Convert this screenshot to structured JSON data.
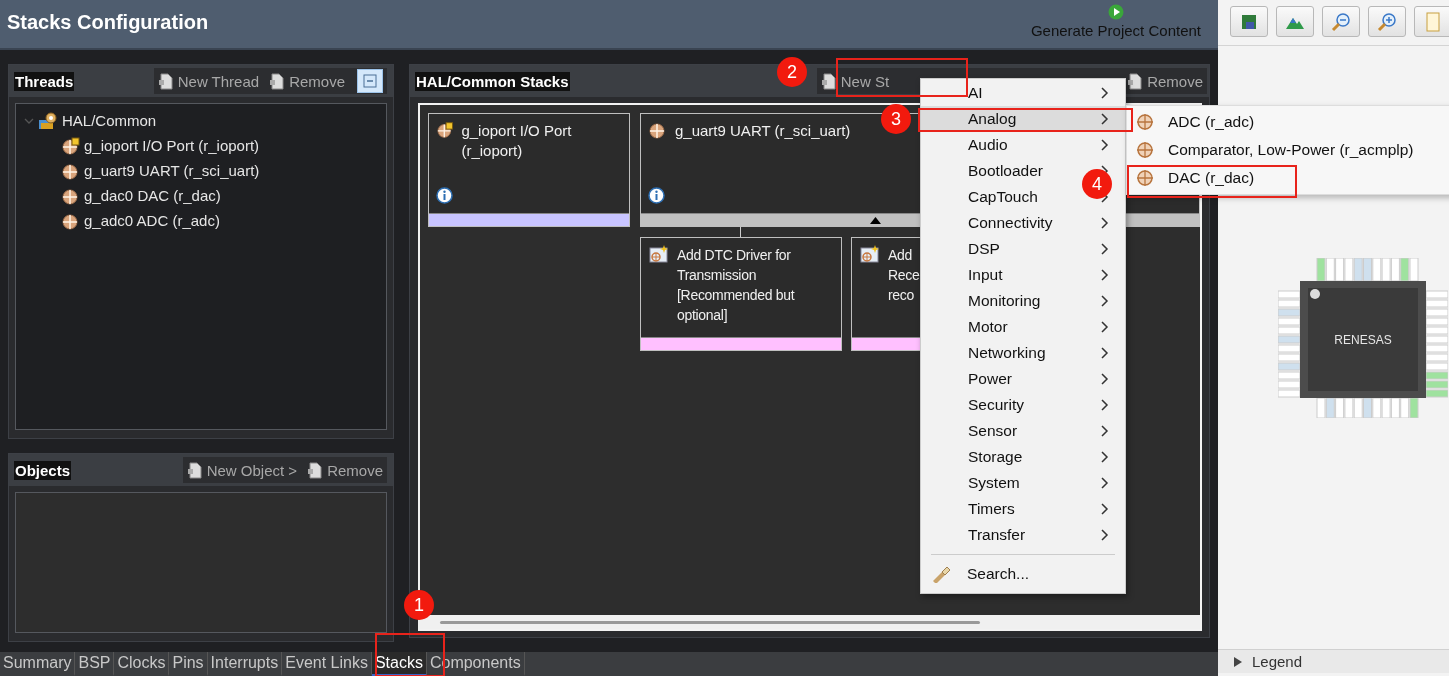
{
  "header": {
    "title": "Stacks Configuration",
    "generate_button": "Generate Project Content"
  },
  "threads_panel": {
    "title": "Threads",
    "buttons": [
      "New Thread",
      "Remove"
    ],
    "tree": [
      {
        "label": "HAL/Common",
        "expanded": true,
        "children": [
          {
            "label": "g_ioport I/O Port (r_ioport)",
            "badge": true
          },
          {
            "label": "g_uart9 UART (r_sci_uart)",
            "badge": false
          },
          {
            "label": "g_dac0 DAC (r_dac)",
            "badge": false
          },
          {
            "label": "g_adc0 ADC (r_adc)",
            "badge": false
          }
        ]
      }
    ]
  },
  "objects_panel": {
    "title": "Objects",
    "buttons": [
      "New Object >",
      "Remove"
    ]
  },
  "stacks_panel": {
    "title": "HAL/Common Stacks",
    "buttons": [
      "New St",
      "Remove"
    ],
    "stacks": [
      {
        "label": "g_ioport I/O Port (r_ioport)",
        "badge": true,
        "color": "#c8c4ff",
        "expanded": false
      },
      {
        "label": "g_uart9 UART (r_sci_uart)",
        "badge": false,
        "color": "#c0c0c0",
        "expanded": true,
        "children": [
          {
            "lines": [
              "Add DTC Driver for",
              "Transmission",
              "[Recommended but",
              "optional]"
            ],
            "color": "#ffc0ff"
          },
          {
            "lines": [
              "Add",
              "Rece",
              "reco"
            ],
            "color": "#ffc0ff"
          }
        ]
      }
    ]
  },
  "context_menu": {
    "items": [
      {
        "label": "AI",
        "selected": false
      },
      {
        "label": "Analog",
        "selected": true
      },
      {
        "label": "Audio",
        "selected": false
      },
      {
        "label": "Bootloader",
        "selected": false
      },
      {
        "label": "CapTouch",
        "selected": false
      },
      {
        "label": "Connectivity",
        "selected": false
      },
      {
        "label": "DSP",
        "selected": false
      },
      {
        "label": "Input",
        "selected": false
      },
      {
        "label": "Monitoring",
        "selected": false
      },
      {
        "label": "Motor",
        "selected": false
      },
      {
        "label": "Networking",
        "selected": false
      },
      {
        "label": "Power",
        "selected": false
      },
      {
        "label": "Security",
        "selected": false
      },
      {
        "label": "Sensor",
        "selected": false
      },
      {
        "label": "Storage",
        "selected": false
      },
      {
        "label": "System",
        "selected": false
      },
      {
        "label": "Timers",
        "selected": false
      },
      {
        "label": "Transfer",
        "selected": false
      }
    ],
    "search": "Search..."
  },
  "submenu": {
    "items": [
      {
        "label": "ADC (r_adc)"
      },
      {
        "label": "Comparator, Low-Power (r_acmplp)"
      },
      {
        "label": "DAC (r_dac)"
      }
    ]
  },
  "bottom_tabs": [
    {
      "label": "Summary",
      "selected": false
    },
    {
      "label": "BSP",
      "selected": false
    },
    {
      "label": "Clocks",
      "selected": false
    },
    {
      "label": "Pins",
      "selected": false
    },
    {
      "label": "Interrupts",
      "selected": false
    },
    {
      "label": "Event Links",
      "selected": false
    },
    {
      "label": "Stacks",
      "selected": true
    },
    {
      "label": "Components",
      "selected": false
    }
  ],
  "right_panel": {
    "chip_label": "RENESAS",
    "legend": {
      "label": "Legend",
      "expanded": false
    }
  },
  "annotations": [
    "1",
    "2",
    "3",
    "4"
  ]
}
